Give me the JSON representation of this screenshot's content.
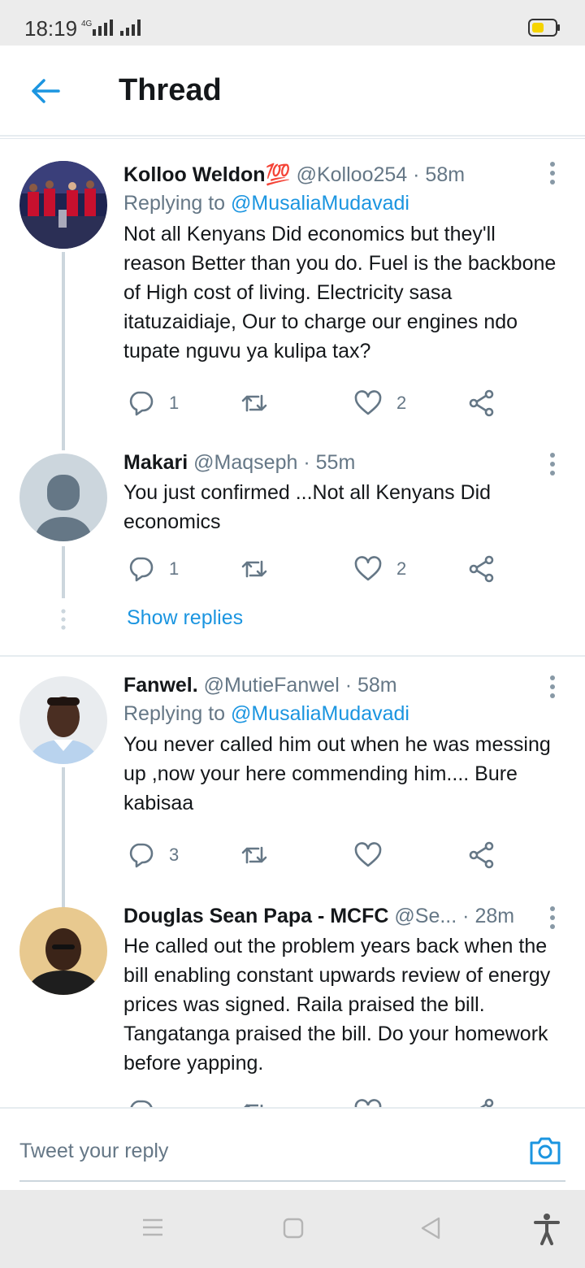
{
  "status_bar": {
    "time": "18:19",
    "network": "4G"
  },
  "header": {
    "title": "Thread"
  },
  "tweets": [
    {
      "name": "Kolloo Weldon💯",
      "handle": "@Kolloo254",
      "time": "58m",
      "replying_prefix": "Replying to ",
      "replying_to": "@MusaliaMudavadi",
      "text": "Not all Kenyans Did economics but they'll reason Better than you do. Fuel is the backbone of High cost of living. Electricity sasa itatuzaidiaje, Our to charge our engines ndo tupate nguvu ya kulipa tax?",
      "reply_count": "1",
      "retweet_count": "",
      "like_count": "2"
    },
    {
      "name": "Makari",
      "handle": "@Maqseph",
      "time": "55m",
      "text": "You just confirmed ...Not all Kenyans Did economics",
      "reply_count": "1",
      "retweet_count": "",
      "like_count": "2"
    },
    {
      "name": "Fanwel.",
      "handle": "@MutieFanwel",
      "time": "58m",
      "replying_prefix": "Replying to ",
      "replying_to": "@MusaliaMudavadi",
      "text": "You never called him out when he was messing up ,now your here commending him.... Bure kabisaa",
      "reply_count": "3",
      "retweet_count": "",
      "like_count": ""
    },
    {
      "name": "Douglas Sean Papa - MCFC",
      "handle": "@Se...",
      "time": "28m",
      "text": "He called out the problem years back when the bill enabling constant upwards review of energy prices was signed. Raila praised the bill. Tangatanga praised the bill. Do your homework before yapping."
    }
  ],
  "separator": "·",
  "show_replies": "Show replies",
  "composer": {
    "placeholder": "Tweet your reply"
  },
  "colors": {
    "accent": "#1b95e0",
    "muted": "#657786",
    "line": "#ccd6dd"
  }
}
